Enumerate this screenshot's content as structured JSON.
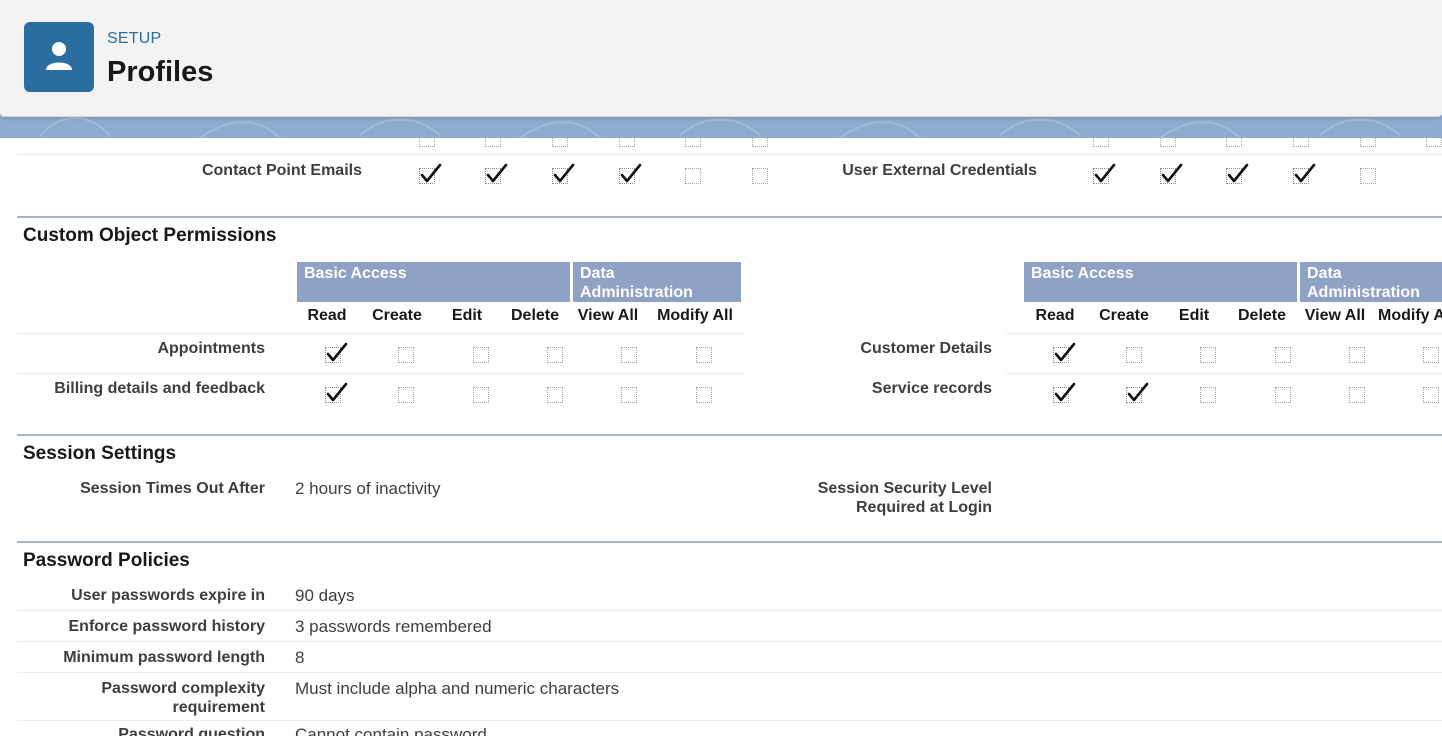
{
  "header": {
    "eyebrow": "SETUP",
    "title": "Profiles",
    "icon": "user-icon"
  },
  "object_permissions_partial": {
    "left": {
      "label": "Contact Point Emails",
      "checks": [
        true,
        true,
        true,
        true,
        false,
        false
      ]
    },
    "right": {
      "label": "User External Credentials",
      "checks": [
        true,
        true,
        true,
        true,
        false
      ]
    }
  },
  "custom_objects": {
    "title": "Custom Object Permissions",
    "group_headers": {
      "basic": "Basic Access",
      "data_admin_line1": "Data",
      "data_admin_line2": "Administration"
    },
    "columns": [
      "Read",
      "Create",
      "Edit",
      "Delete",
      "View All",
      "Modify All"
    ],
    "right_columns": [
      "Read",
      "Create",
      "Edit",
      "Delete",
      "View All",
      "Modify A"
    ],
    "left_rows": [
      {
        "label": "Appointments",
        "checks": [
          true,
          false,
          false,
          false,
          false,
          false
        ]
      },
      {
        "label": "Billing details and feedback",
        "checks": [
          true,
          false,
          false,
          false,
          false,
          false
        ]
      }
    ],
    "right_rows": [
      {
        "label": "Customer Details",
        "checks": [
          true,
          false,
          false,
          false,
          false,
          false
        ]
      },
      {
        "label": "Service records",
        "checks": [
          true,
          true,
          false,
          false,
          false,
          false
        ]
      }
    ]
  },
  "session": {
    "title": "Session Settings",
    "timeout_label": "Session Times Out After",
    "timeout_value": "2 hours of inactivity",
    "security_label_line1": "Session Security Level",
    "security_label_line2": "Required at Login"
  },
  "password": {
    "title": "Password Policies",
    "rows": [
      {
        "label": "User passwords expire in",
        "value": "90 days"
      },
      {
        "label": "Enforce password history",
        "value": "3 passwords remembered"
      },
      {
        "label": "Minimum password length",
        "value": "8"
      },
      {
        "label_line1": "Password complexity",
        "label_line2": "requirement",
        "value": "Must include alpha and numeric characters"
      },
      {
        "label": "Password question",
        "value": "Cannot contain password"
      }
    ]
  },
  "colors": {
    "accent": "#2b6d9e",
    "band": "#8fa9cf",
    "table_header": "#8fa1c4"
  }
}
